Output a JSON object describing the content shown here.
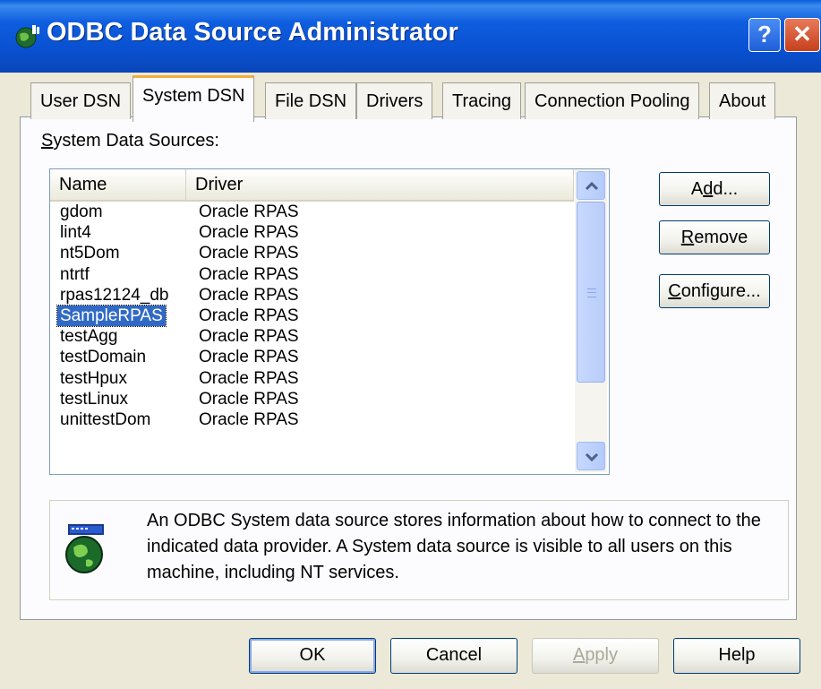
{
  "window": {
    "title": "ODBC Data Source Administrator",
    "help_glyph": "?",
    "close_glyph": "✕",
    "icon": "globe-database-icon"
  },
  "tabs": [
    {
      "label": "User DSN",
      "active": false
    },
    {
      "label": "System DSN",
      "active": true
    },
    {
      "label": "File DSN",
      "active": false
    },
    {
      "label": "Drivers",
      "active": false
    },
    {
      "label": "Tracing",
      "active": false
    },
    {
      "label": "Connection Pooling",
      "active": false
    },
    {
      "label": "About",
      "active": false
    }
  ],
  "section": {
    "label_prefix": "S",
    "label_rest": "ystem Data Sources:"
  },
  "list": {
    "columns": [
      "Name",
      "Driver"
    ],
    "rows": [
      {
        "name": "gdom",
        "driver": "Oracle RPAS"
      },
      {
        "name": "lint4",
        "driver": "Oracle RPAS"
      },
      {
        "name": "nt5Dom",
        "driver": "Oracle RPAS"
      },
      {
        "name": "ntrtf",
        "driver": "Oracle RPAS"
      },
      {
        "name": "rpas12124_db",
        "driver": "Oracle RPAS"
      },
      {
        "name": "SampleRPAS",
        "driver": "Oracle RPAS",
        "selected": true
      },
      {
        "name": "testAgg",
        "driver": "Oracle RPAS"
      },
      {
        "name": "testDomain",
        "driver": "Oracle RPAS"
      },
      {
        "name": "testHpux",
        "driver": "Oracle RPAS"
      },
      {
        "name": "testLinux",
        "driver": "Oracle RPAS"
      },
      {
        "name": "unittestDom",
        "driver": "Oracle RPAS"
      }
    ]
  },
  "side_buttons": {
    "add_pre": "A",
    "add_mn": "d",
    "add_post": "d...",
    "remove_mn": "R",
    "remove_post": "emove",
    "configure_mn": "C",
    "configure_post": "onfigure..."
  },
  "info": {
    "text": "An ODBC System data source stores information about how to connect to the indicated data provider.  A System data source is visible to all users on this machine, including NT services.",
    "icon": "odbc-globe-icon"
  },
  "footer": {
    "ok": "OK",
    "cancel": "Cancel",
    "apply_mn": "A",
    "apply_post": "pply",
    "help": "Help"
  }
}
